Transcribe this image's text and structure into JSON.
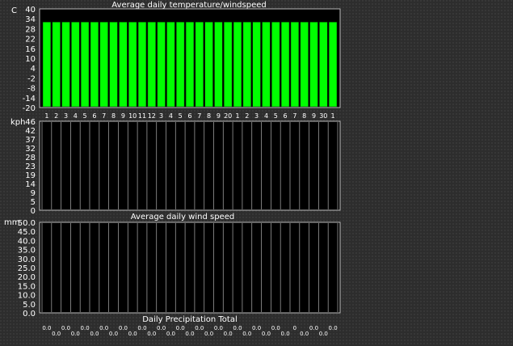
{
  "chart_data": [
    {
      "type": "bar",
      "title": "Average daily temperature/windspeed",
      "ylabel": "C",
      "ylim": [
        -20,
        40
      ],
      "yticks": [
        "40",
        "34",
        "28",
        "22",
        "16",
        "10",
        "4",
        "-2",
        "-8",
        "-14",
        "-20"
      ],
      "categories": [
        "1",
        "2",
        "3",
        "4",
        "5",
        "6",
        "7",
        "8",
        "9",
        "10",
        "11",
        "12",
        "3",
        "4",
        "5",
        "6",
        "7",
        "8",
        "9",
        "20",
        "1",
        "2",
        "3",
        "4",
        "5",
        "6",
        "7",
        "8",
        "9",
        "30",
        "1"
      ],
      "values": [
        32,
        32,
        32,
        32,
        32,
        32,
        32,
        32,
        32,
        32,
        32,
        32,
        32,
        32,
        32,
        32,
        32,
        32,
        32,
        32,
        32,
        32,
        32,
        32,
        32,
        32,
        32,
        32,
        32,
        32,
        32
      ],
      "bar_color": "#00ff00",
      "grid": true
    },
    {
      "type": "bar",
      "title": "Average daily wind speed",
      "ylabel": "kph",
      "ylim": [
        0,
        46
      ],
      "yticks": [
        "46",
        "42",
        "37",
        "32",
        "28",
        "23",
        "19",
        "14",
        "9",
        "5",
        "0"
      ],
      "values": [
        0,
        0,
        0,
        0,
        0,
        0,
        0,
        0,
        0,
        0,
        0,
        0,
        0,
        0,
        0,
        0,
        0,
        0,
        0,
        0,
        0,
        0,
        0,
        0,
        0,
        0,
        0,
        0,
        0,
        0,
        0
      ],
      "grid": true
    },
    {
      "type": "bar",
      "title": "Daily Precipitation Total",
      "ylabel": "mm",
      "ylim": [
        0,
        50
      ],
      "yticks": [
        "50.0",
        "45.0",
        "40.0",
        "35.0",
        "30.0",
        "25.0",
        "20.0",
        "15.0",
        "10.0",
        "5.0",
        "0.0"
      ],
      "values": [
        0,
        0,
        0,
        0,
        0,
        0,
        0,
        0,
        0,
        0,
        0,
        0,
        0,
        0,
        0,
        0,
        0,
        0,
        0,
        0,
        0,
        0,
        0,
        0,
        0,
        0,
        0,
        0,
        0,
        0,
        0
      ],
      "value_labels": [
        "0.0",
        "0.0",
        "0.0",
        "0.0",
        "0.0",
        "0.0",
        "0.0",
        "0.0",
        "0.0",
        "0.0",
        "0.0",
        "0.0",
        "0.0",
        "0.0",
        "0.0",
        "0.0",
        "0.0",
        "0.0",
        "0.0",
        "0.0",
        "0.0",
        "0.0",
        "0.0",
        "0.0",
        "0.0",
        "0.0",
        "0",
        "0.0",
        "0.0",
        "0.0",
        "0.0"
      ],
      "grid": true
    }
  ]
}
